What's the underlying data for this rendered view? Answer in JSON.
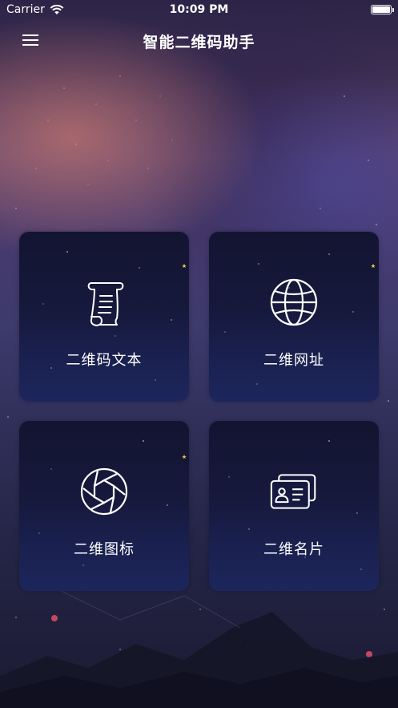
{
  "status_bar": {
    "carrier": "Carrier",
    "time": "10:09 PM",
    "wifi_icon": "wifi-icon",
    "battery_icon": "battery-icon"
  },
  "nav": {
    "title": "智能二维码助手",
    "menu_icon": "hamburger-menu-icon"
  },
  "cards": [
    {
      "label": "二维码文本",
      "icon": "scroll-document-icon"
    },
    {
      "label": "二维网址",
      "icon": "globe-icon"
    },
    {
      "label": "二维图标",
      "icon": "camera-aperture-icon"
    },
    {
      "label": "二维名片",
      "icon": "business-card-icon"
    }
  ],
  "colors": {
    "card_top": "#131431",
    "card_bottom": "#1d265c",
    "text": "#ffffff",
    "star_accent": "#f2c94c"
  }
}
